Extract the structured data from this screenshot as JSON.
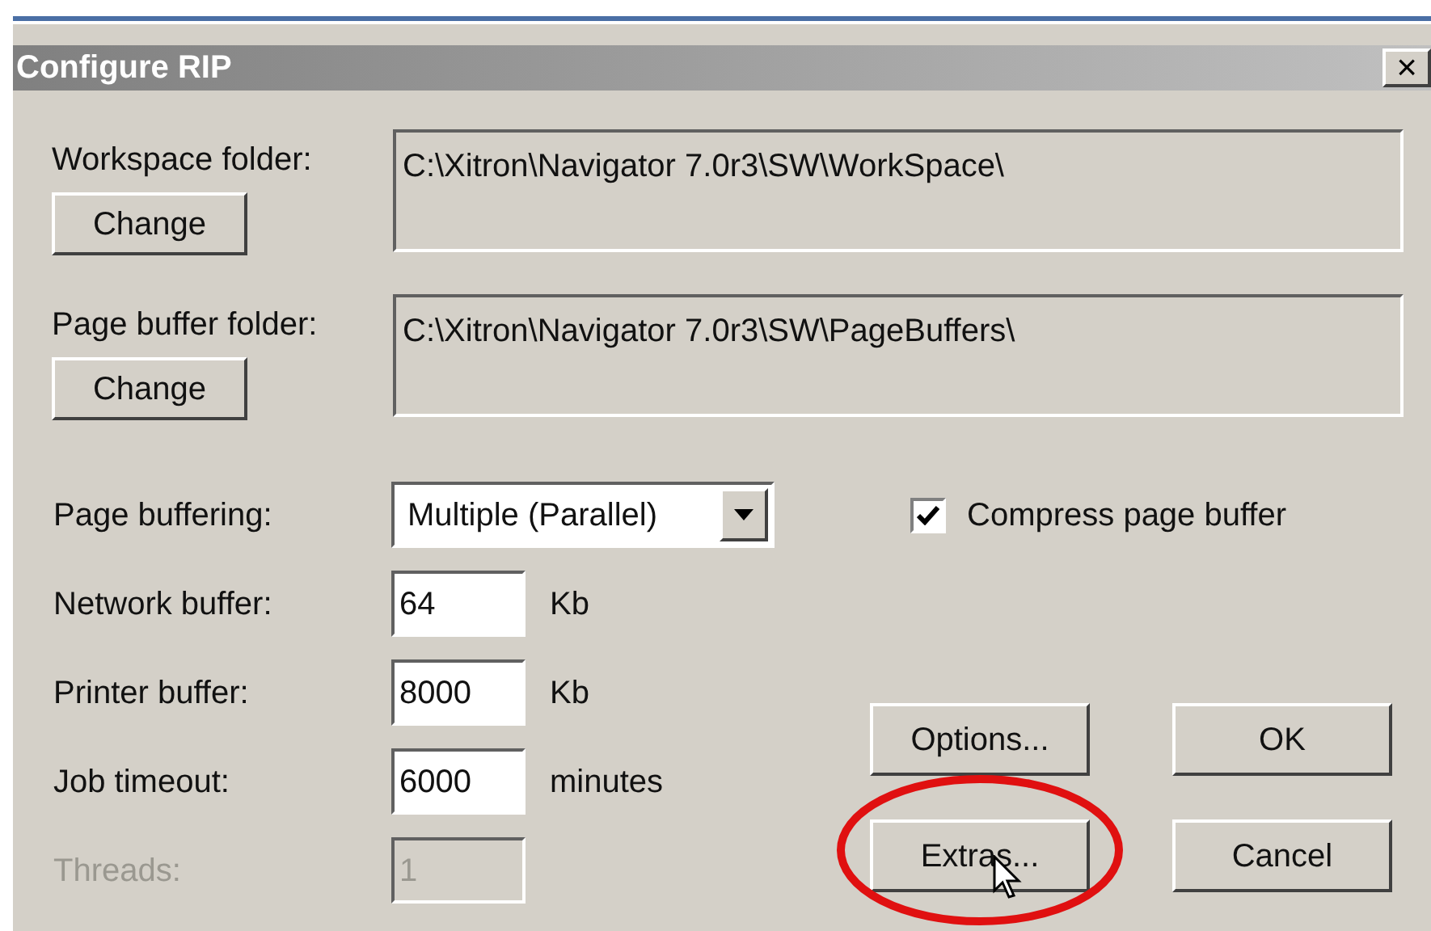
{
  "window": {
    "title": "Configure RIP",
    "close": "×"
  },
  "folders": [
    {
      "label": "Workspace folder:",
      "path": "C:\\Xitron\\Navigator 7.0r3\\SW\\WorkSpace\\",
      "button": "Change"
    },
    {
      "label": "Page buffer folder:",
      "path": "C:\\Xitron\\Navigator 7.0r3\\SW\\PageBuffers\\",
      "button": "Change"
    }
  ],
  "fields": [
    {
      "kind": "dropdown",
      "label": "Page buffering:",
      "value": "Multiple (Parallel)",
      "disabled": false
    },
    {
      "kind": "number",
      "label": "Network buffer:",
      "value": "64",
      "unit": "Kb",
      "disabled": false
    },
    {
      "kind": "number",
      "label": "Printer buffer:",
      "value": "8000",
      "unit": "Kb",
      "disabled": false
    },
    {
      "kind": "number",
      "label": "Job timeout:",
      "value": "6000",
      "unit": "minutes",
      "disabled": false
    },
    {
      "kind": "number",
      "label": "Threads:",
      "value": "1",
      "disabled": true
    }
  ],
  "checkbox": {
    "label": "Compress page buffer",
    "checked": true
  },
  "buttons": [
    {
      "label": "Options...",
      "highlighted": false,
      "hovered": false
    },
    {
      "label": "OK",
      "highlighted": false,
      "hovered": false
    },
    {
      "label": "Extras...",
      "highlighted": true,
      "hovered": true
    },
    {
      "label": "Cancel",
      "highlighted": false,
      "hovered": false
    }
  ]
}
